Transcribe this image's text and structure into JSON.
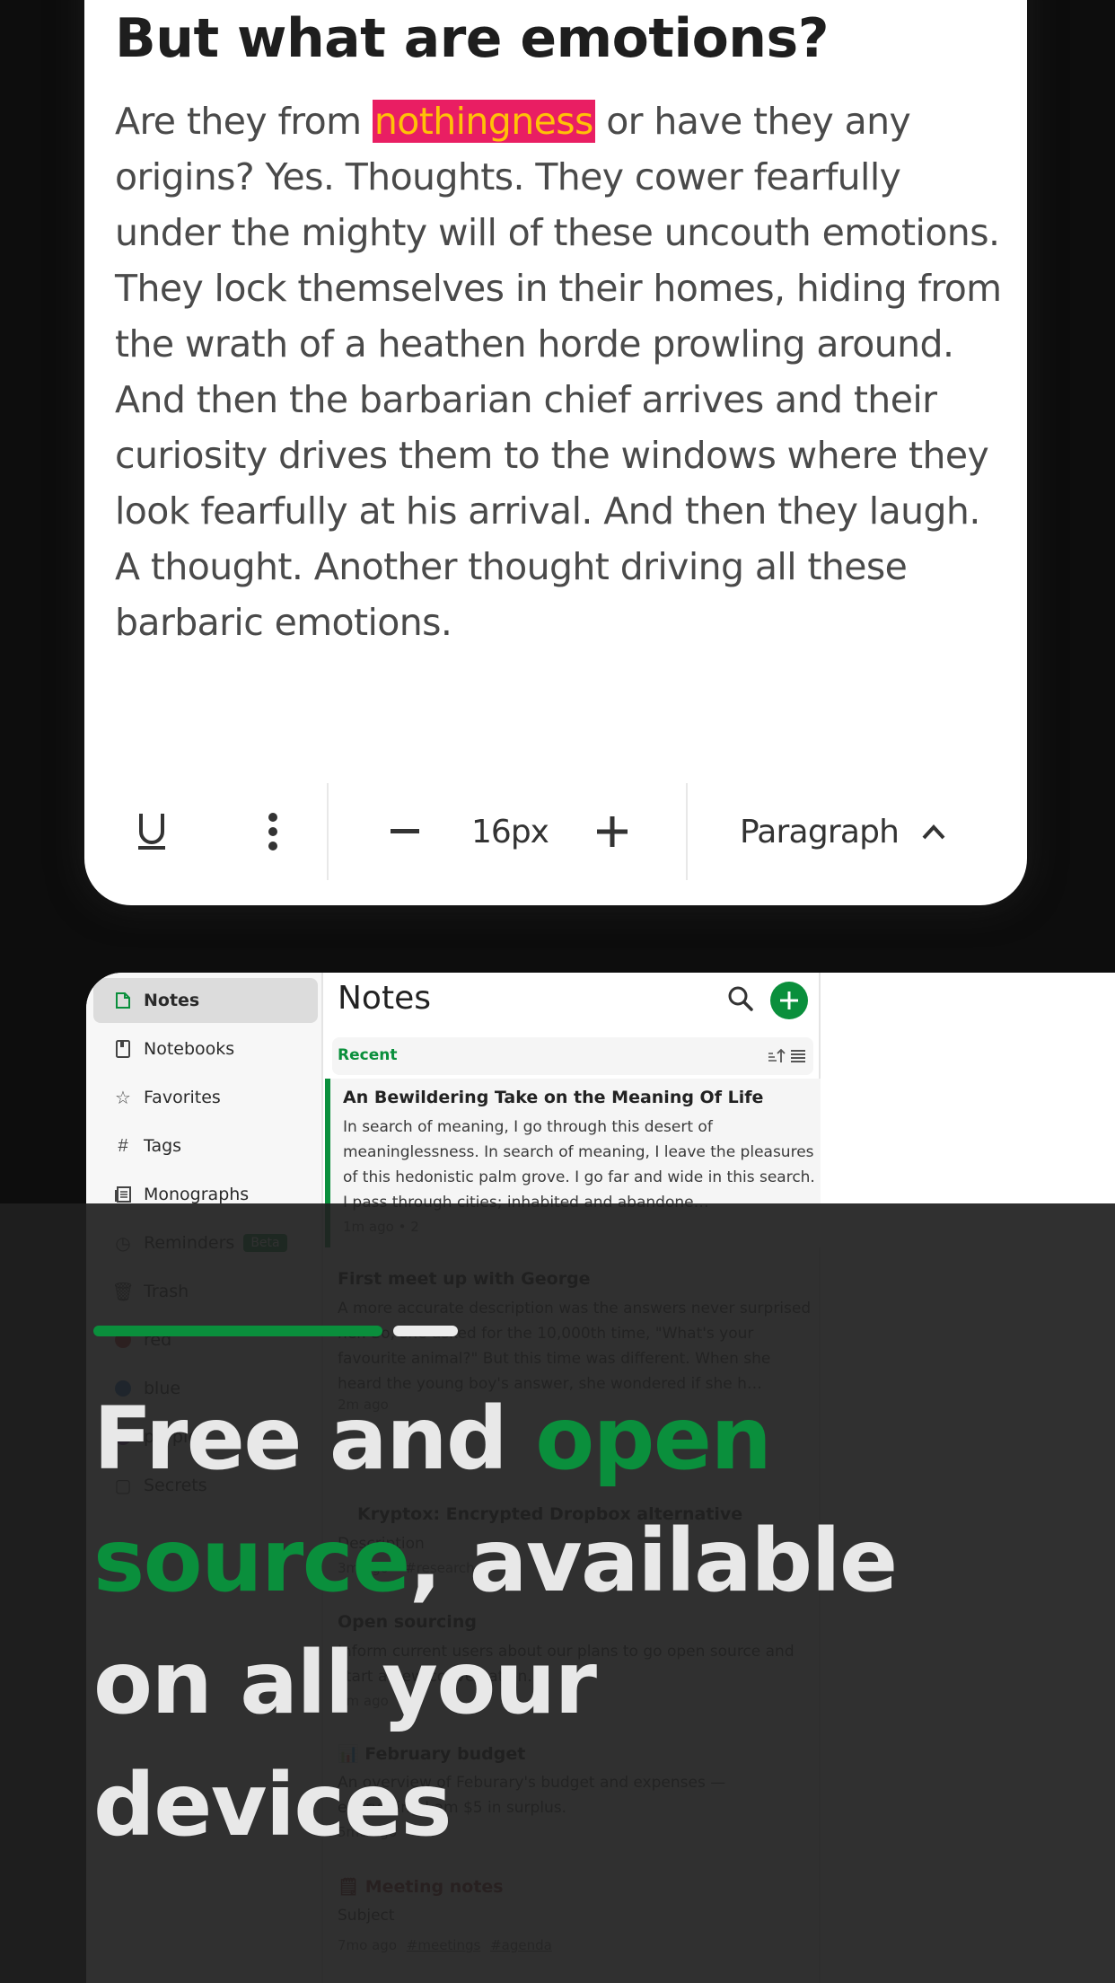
{
  "editor": {
    "heading": "But what are emotions?",
    "body_before": "Are they from ",
    "body_highlight": "nothingness",
    "body_after": " or have they any origins? Yes. Thoughts. They cower fearfully under the mighty will of these uncouth emotions. They lock themselves in their homes, hiding from the wrath of a heathen horde prowling around. And then the barbarian chief arrives and their curiosity drives them to the windows where they look fearfully at his arrival. And then they laugh. A thought. Another thought driving all these barbaric emotions.",
    "highlight_colors": {
      "background": "#e91e63",
      "text": "#ffc107"
    },
    "toolbar": {
      "underline_icon": "underline-icon",
      "more_icon": "more-vertical-icon",
      "decrease_icon": "minus-icon",
      "font_size": "16px",
      "increase_icon": "plus-icon",
      "block_type": "Paragraph",
      "block_type_icon": "chevron-up-icon"
    }
  },
  "app": {
    "sidebar": {
      "items": [
        {
          "label": "Notes",
          "icon": "note-icon",
          "active": true
        },
        {
          "label": "Notebooks",
          "icon": "notebook-icon"
        },
        {
          "label": "Favorites",
          "icon": "star-icon"
        },
        {
          "label": "Tags",
          "icon": "hash-icon"
        },
        {
          "label": "Monographs",
          "icon": "monograph-icon"
        },
        {
          "label": "Reminders",
          "icon": "clock-icon",
          "badge": "Beta"
        },
        {
          "label": "Trash",
          "icon": "trash-icon"
        },
        {
          "label": "red",
          "icon": "color-dot-icon",
          "color": "#c62828"
        },
        {
          "label": "blue",
          "icon": "color-dot-icon",
          "color": "#1565c0"
        },
        {
          "label": "purple",
          "icon": "color-dot-icon",
          "color": "#6a1b9a"
        },
        {
          "label": "Secrets",
          "icon": "notebook-icon"
        }
      ]
    },
    "notes_pane": {
      "title": "Notes",
      "search_icon": "search-icon",
      "add_icon": "plus-icon",
      "group_label": "Recent",
      "sort_icon": "sort-ascending-icon",
      "view_icon": "list-view-icon",
      "notes": [
        {
          "title": "An Bewildering Take on the Meaning Of Life",
          "excerpt": "In search of meaning, I go through this desert of meaninglessness. In search of meaning, I leave the pleasures of this hedonistic palm grove. I go far and wide in this search. I pass through cities; inhabited and abandone…",
          "meta": "1m ago • 2"
        },
        {
          "title": "First meet up with George",
          "excerpt": "A more accurate description was the answers never surprised her. So, she asked for the 10,000th time, \"What's your favourite animal?\" But this time was different. When she heard the young boy's answer, she wondered if she h…",
          "meta": "2m ago"
        },
        {
          "title": "Kryptox: Encrypted Dropbox alternative",
          "excerpt": "Description",
          "meta": "3m ago • #research"
        },
        {
          "title": "Open sourcing",
          "excerpt": "Inform current users about our plans to go open source and start a new conversation.",
          "meta": "4m ago"
        },
        {
          "title": "📊 February budget",
          "excerpt": "An overview of Feburary's budget and expenses — everything I am $5 in surplus.",
          "meta": "5mo ago"
        },
        {
          "title": "🗒 Meeting notes",
          "excerpt": "Subject",
          "meta": "7mo ago",
          "tags": [
            "#meetings",
            "#agenda"
          ]
        }
      ]
    }
  },
  "onboarding": {
    "progress": {
      "current_step": 1,
      "total_steps": 2
    },
    "hero_line1_plain": "Free and ",
    "hero_line1_accent": "open",
    "hero_line2_accent": "source",
    "hero_line2_plain": ", available",
    "hero_line3": "on all your",
    "hero_line4": "devices",
    "accent_color": "#0a8f3c"
  }
}
